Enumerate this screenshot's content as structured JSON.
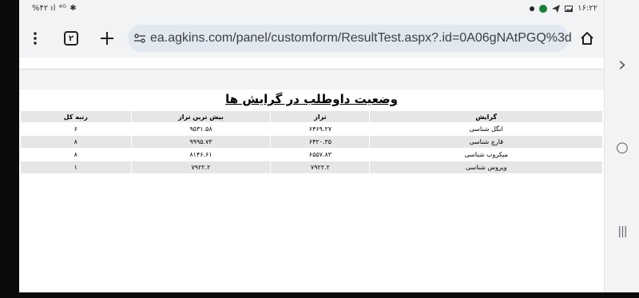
{
  "status_bar": {
    "left": "%۴۲ ‎ıl‎ ⁴ᴳ ✱",
    "time": "۱۶:۲۲"
  },
  "toolbar": {
    "tab_count": "۲",
    "url": "ea.agkins.com/panel/customform/ResultTest.aspx?.id=0A06gNAtPGQ%3d"
  },
  "page": {
    "title": "وضعیت داوطلب در گرایش ها",
    "table": {
      "headers": [
        "گرایش",
        "تراز",
        "بیش ترین تراز",
        "رتبه کل"
      ],
      "rows": [
        [
          "انگل شناسی",
          "۶۴۶۹.۲۷",
          "۹۵۳۱.۵۸",
          "۶"
        ],
        [
          "قارچ شناسی",
          "۶۴۲۰.۳۵",
          "۹۹۹۵.۷۳",
          "۸"
        ],
        [
          "میکروب شناسی",
          "۶۵۵۷.۸۳",
          "۸۱۴۶.۶۱",
          "۸"
        ],
        [
          "ویروس شناسی",
          "۷۹۲۲.۲",
          "۷۹۲۲.۲",
          "۱"
        ]
      ]
    }
  },
  "nav_rail": {
    "forward_glyph": "›",
    "home_glyph": "○",
    "recents_glyph": "|||"
  }
}
